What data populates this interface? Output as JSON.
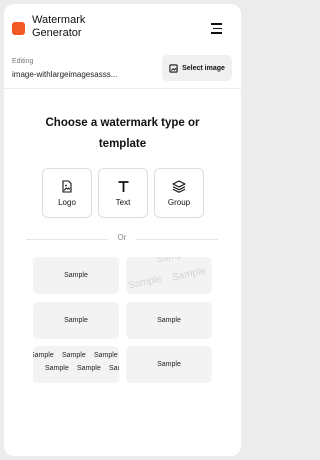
{
  "header": {
    "app_title": "Watermark Generator"
  },
  "editing": {
    "label": "Editing",
    "file_name": "image-withlargeimagesasss...",
    "select_label": "Select image"
  },
  "heading": "Choose a watermark type or template",
  "types": [
    {
      "label": "Logo",
      "icon": "image-icon"
    },
    {
      "label": "Text",
      "icon": "text-t-icon"
    },
    {
      "label": "Group",
      "icon": "layers-icon"
    }
  ],
  "or_text": "Or",
  "templates": {
    "sample_text": "Sample",
    "items": [
      {
        "style": "centered"
      },
      {
        "style": "faded-tiled"
      },
      {
        "style": "centered"
      },
      {
        "style": "centered"
      },
      {
        "style": "tiled"
      },
      {
        "style": "centered"
      }
    ]
  },
  "colors": {
    "brand": "#f15a24",
    "card_bg": "#f3f3f3",
    "frame_bg": "#ececec"
  }
}
